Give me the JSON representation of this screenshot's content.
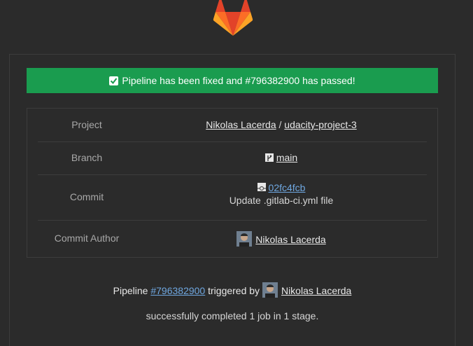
{
  "banner": {
    "text": "Pipeline has been fixed and #796382900 has passed!"
  },
  "rows": {
    "project": {
      "label": "Project",
      "namespace": "Nikolas Lacerda",
      "separator": "/",
      "name": "udacity-project-3"
    },
    "branch": {
      "label": "Branch",
      "value": "main"
    },
    "commit": {
      "label": "Commit",
      "sha": "02fc4fcb",
      "message": "Update .gitlab-ci.yml file"
    },
    "author": {
      "label": "Commit Author",
      "name": "Nikolas Lacerda"
    }
  },
  "footer": {
    "prefix": "Pipeline",
    "pipeline_id": "#796382900",
    "middle": "triggered by",
    "user": "Nikolas Lacerda",
    "summary": "successfully completed 1 job in 1 stage."
  },
  "colors": {
    "background": "#2b2b2b",
    "success": "#1a9c4f",
    "link_blue": "#6fa7e0",
    "border": "#3d3d3d"
  },
  "icons": {
    "logo": "gitlab-tanuki-logo",
    "banner": "check-icon",
    "branch": "branch-icon",
    "commit": "commit-icon"
  }
}
